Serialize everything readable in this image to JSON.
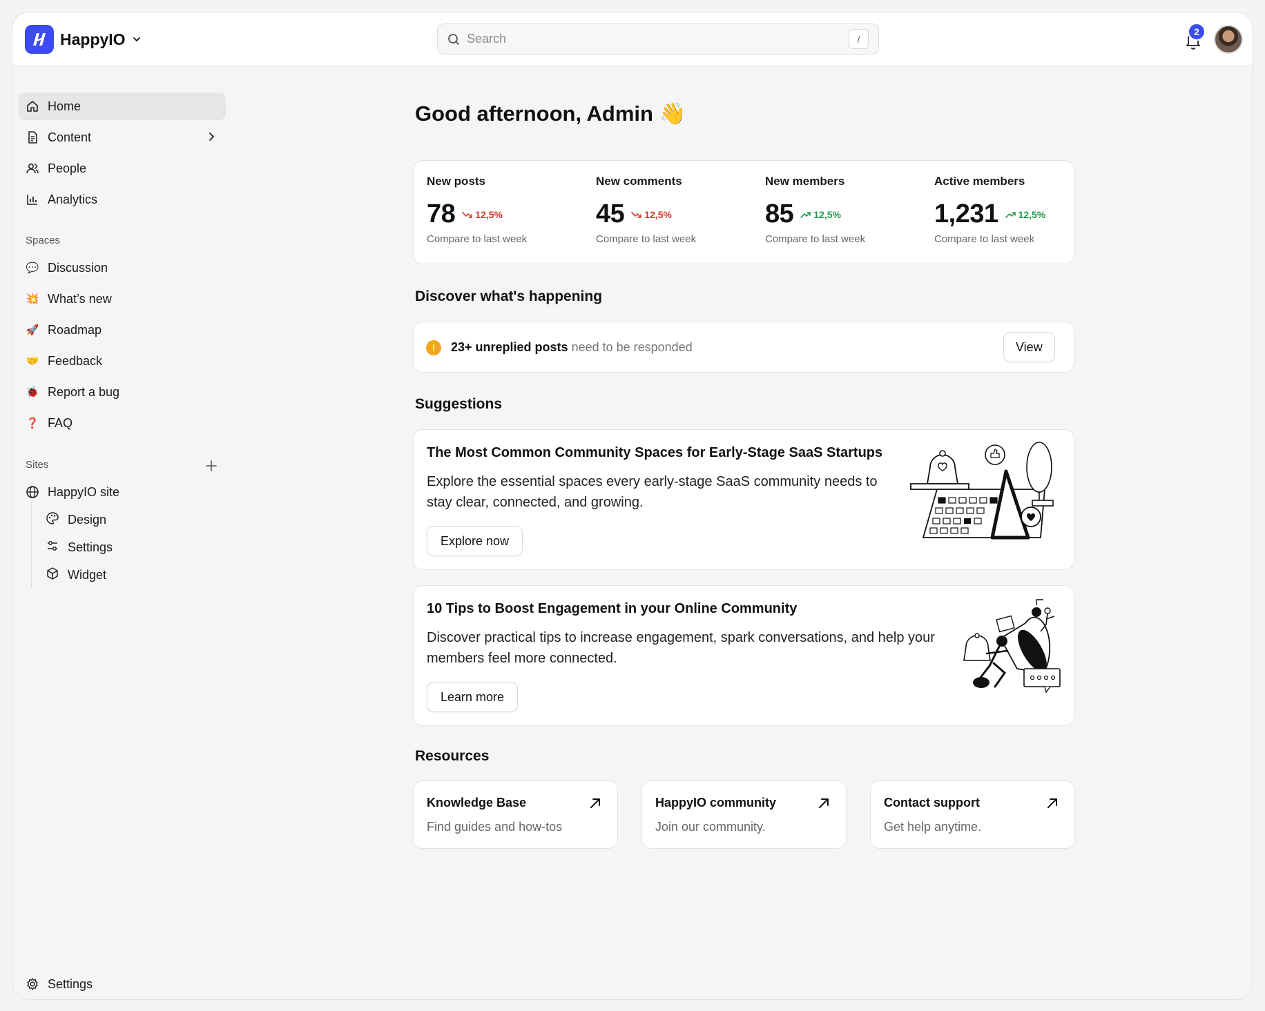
{
  "app": {
    "name": "HappyIO"
  },
  "search": {
    "placeholder": "Search",
    "shortcut": "/"
  },
  "notifications": {
    "count": "2"
  },
  "sidebar": {
    "nav": [
      {
        "label": "Home"
      },
      {
        "label": "Content"
      },
      {
        "label": "People"
      },
      {
        "label": "Analytics"
      }
    ],
    "spaces_label": "Spaces",
    "spaces": [
      {
        "label": "Discussion",
        "emoji": "💬"
      },
      {
        "label": "What’s new",
        "emoji": "💥"
      },
      {
        "label": "Roadmap",
        "emoji": "🚀"
      },
      {
        "label": "Feedback",
        "emoji": "🤝"
      },
      {
        "label": "Report a bug",
        "emoji": "🐞"
      },
      {
        "label": "FAQ",
        "emoji": "❓"
      }
    ],
    "sites_label": "Sites",
    "site": {
      "label": "HappyIO site"
    },
    "site_children": [
      {
        "label": "Design"
      },
      {
        "label": "Settings"
      },
      {
        "label": "Widget"
      }
    ],
    "footer": {
      "label": "Settings"
    }
  },
  "main": {
    "greeting": "Good afternoon, Admin 👋",
    "stats": [
      {
        "title": "New posts",
        "value": "78",
        "trend": "12,5%",
        "direction": "down",
        "note": "Compare to last week"
      },
      {
        "title": "New comments",
        "value": "45",
        "trend": "12,5%",
        "direction": "down",
        "note": "Compare to last week"
      },
      {
        "title": "New members",
        "value": "85",
        "trend": "12,5%",
        "direction": "up",
        "note": "Compare to last week"
      },
      {
        "title": "Active members",
        "value": "1,231",
        "trend": "12,5%",
        "direction": "up",
        "note": "Compare to last week"
      }
    ],
    "discover": {
      "heading": "Discover what's happening",
      "alert_bold": "23+ unreplied posts",
      "alert_text": " need to be responded",
      "alert_icon": "!",
      "button": "View"
    },
    "suggestions": {
      "heading": "Suggestions",
      "items": [
        {
          "title": "The Most Common Community Spaces for Early-Stage SaaS Startups",
          "desc": "Explore the essential spaces every early-stage SaaS community needs to stay clear, connected, and growing.",
          "button": "Explore now"
        },
        {
          "title": "10 Tips to Boost Engagement in your Online Community",
          "desc": "Discover practical tips to increase engagement, spark conversations, and help your members feel more connected.",
          "button": "Learn more"
        }
      ]
    },
    "resources": {
      "heading": "Resources",
      "items": [
        {
          "title": "Knowledge Base",
          "sub": "Find guides and how-tos"
        },
        {
          "title": "HappyIO community",
          "sub": "Join our community."
        },
        {
          "title": "Contact support",
          "sub": "Get help anytime."
        }
      ]
    }
  },
  "colors": {
    "brand": "#3b4cf0",
    "trend_down": "#d2382b",
    "trend_up": "#1f9a4a",
    "alert": "#f2a71b"
  }
}
